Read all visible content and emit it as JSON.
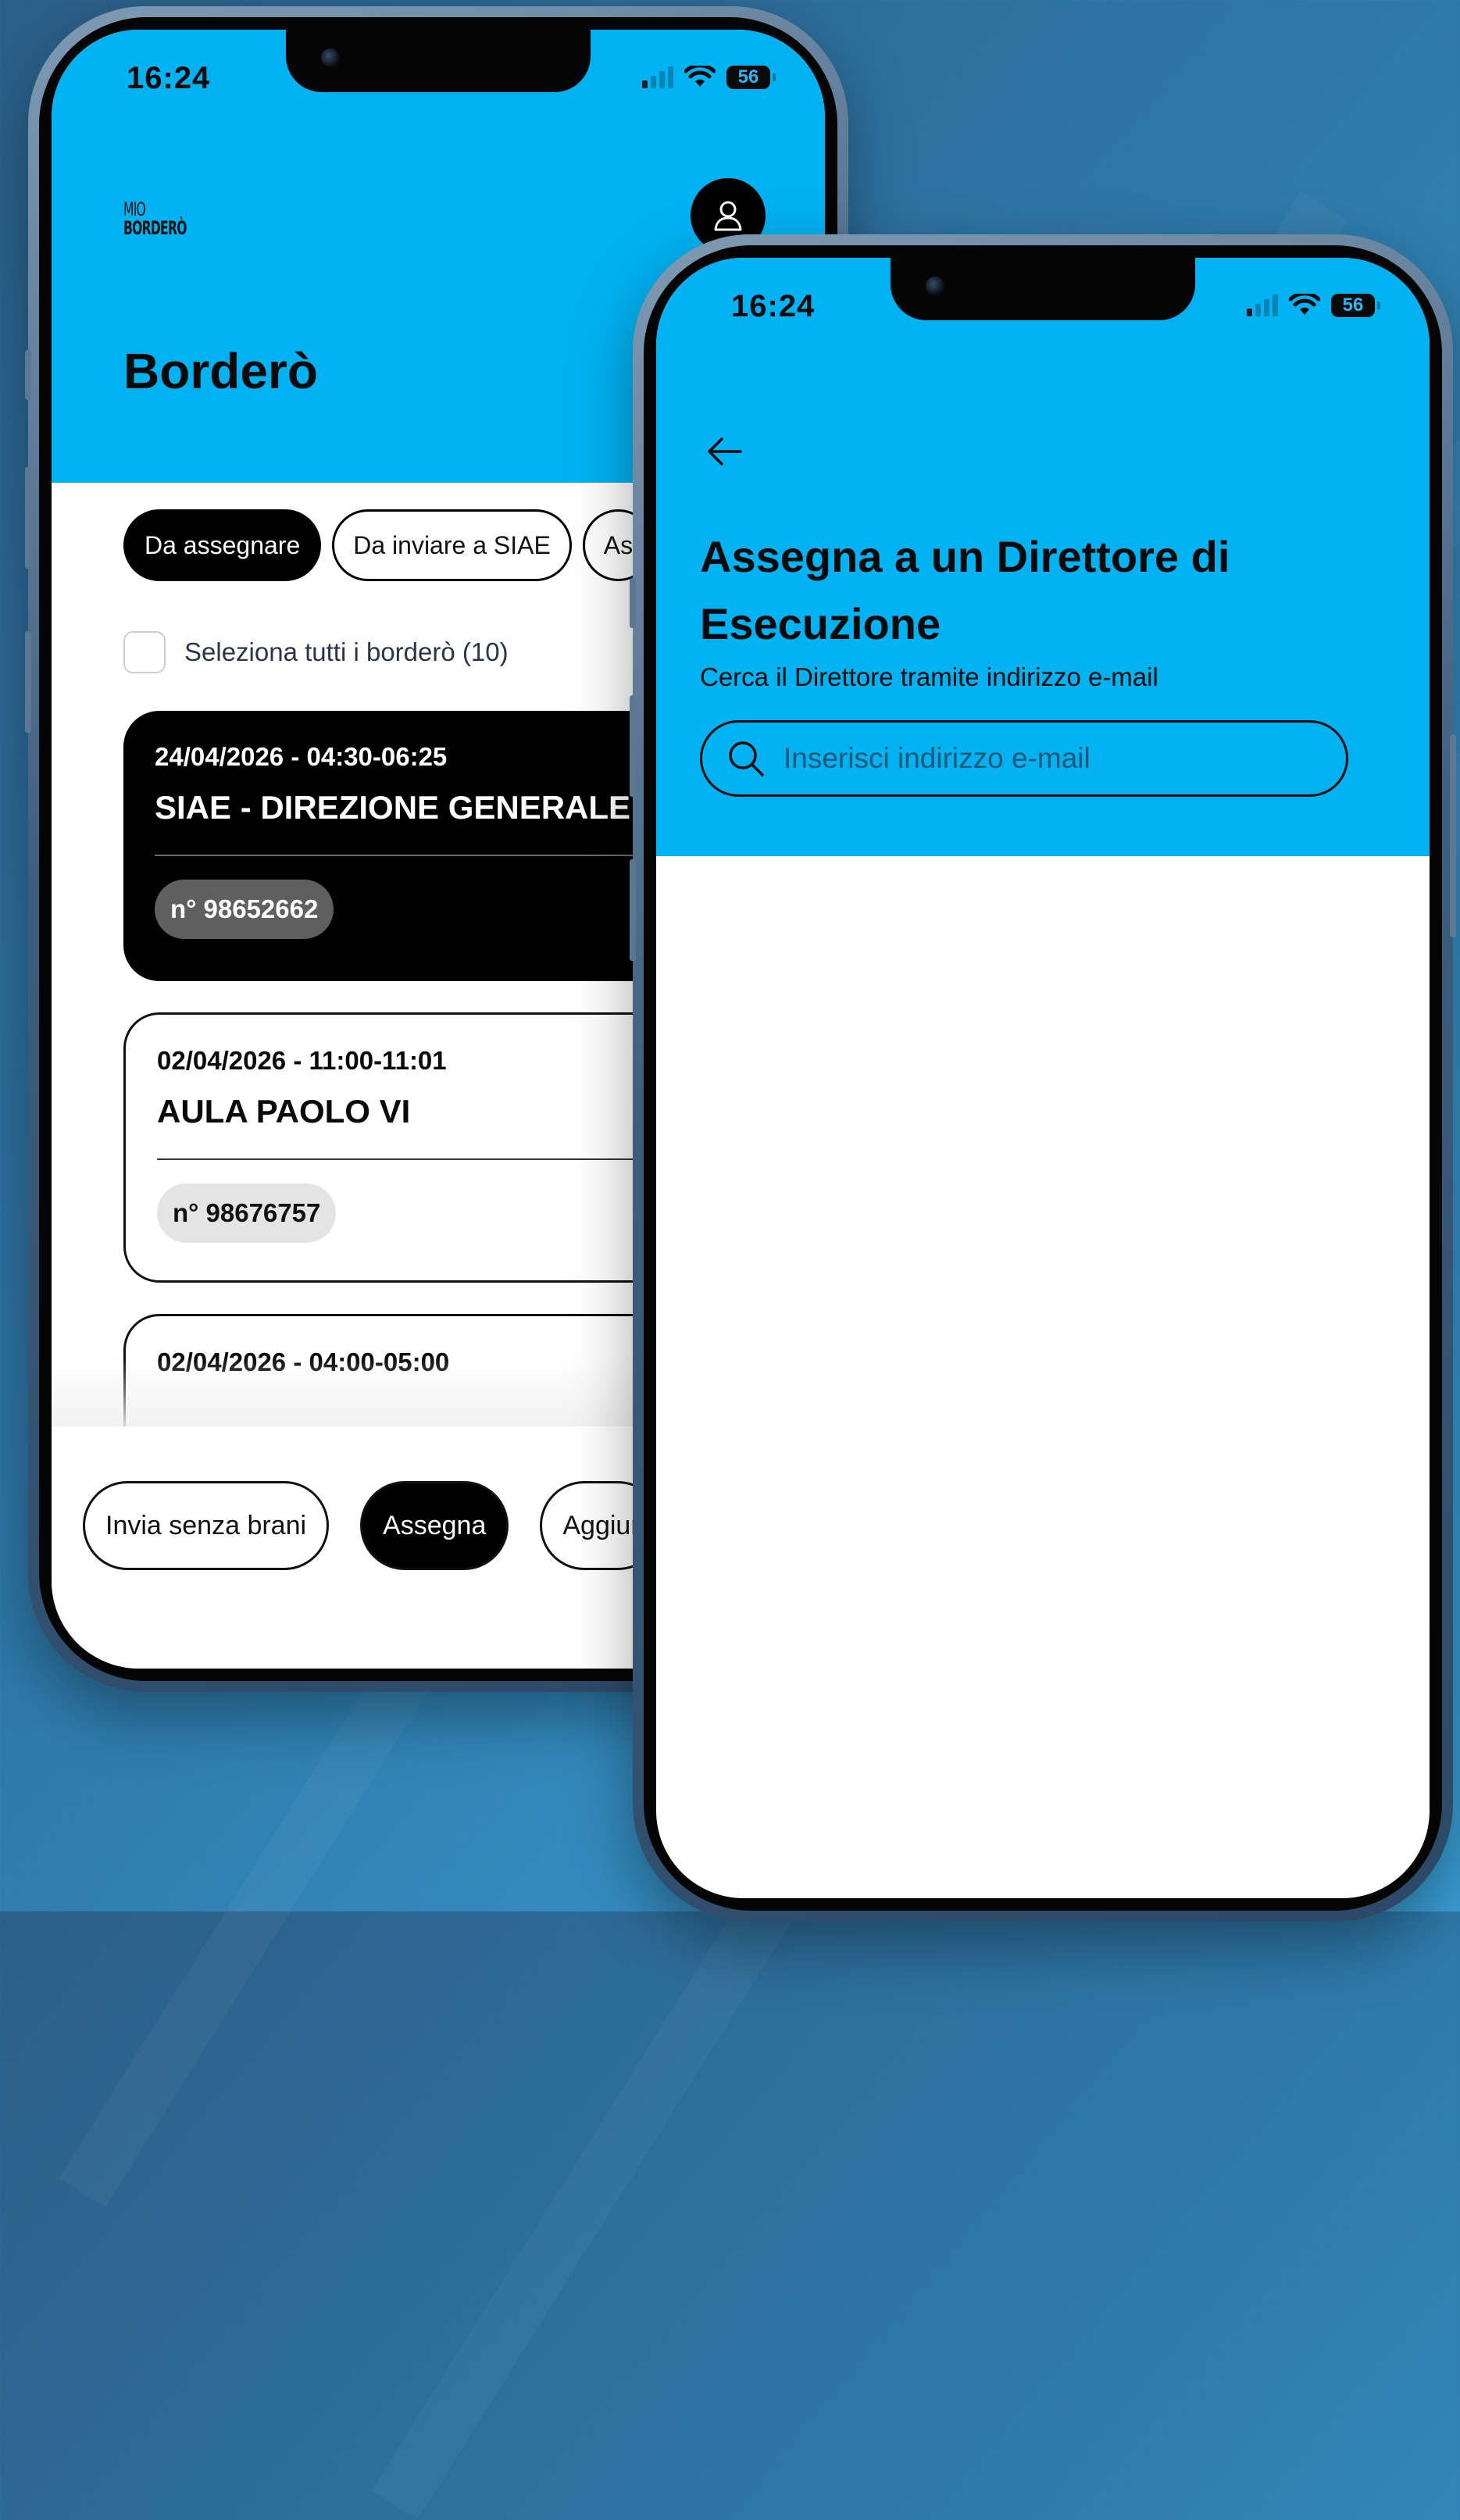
{
  "colors": {
    "brand_blue": "#00b2f2",
    "black": "#000000",
    "white": "#ffffff",
    "chip_dark": "#5f5f5f",
    "chip_light": "#e4e4e4"
  },
  "phone_list": {
    "status_bar": {
      "time": "16:24",
      "battery": "56",
      "icons": [
        "signal-icon",
        "wifi-icon",
        "battery-icon"
      ]
    },
    "logo": {
      "line1": "MIO",
      "line2": "BORDERÒ"
    },
    "profile_icon": "user-icon",
    "title": "Borderò",
    "tabs": [
      {
        "label": "Da assegnare",
        "active": true
      },
      {
        "label": "Da inviare a SIAE",
        "active": false
      },
      {
        "label": "As",
        "active": false
      }
    ],
    "select_all_label": "Seleziona tutti i borderò (10)",
    "cards": [
      {
        "date": "24/04/2026 - 04:30-06:25",
        "place": "SIAE - DIREZIONE GENERALE",
        "number": "n° 98652662",
        "selected": true
      },
      {
        "date": "02/04/2026 - 11:00-11:01",
        "place": "AULA PAOLO VI",
        "number": "n° 98676757",
        "selected": false
      },
      {
        "date": "02/04/2026 - 04:00-05:00",
        "selected": false
      }
    ],
    "actions": [
      {
        "label": "Invia senza brani"
      },
      {
        "label": "Assegna",
        "primary": true
      },
      {
        "label": "Aggiur"
      }
    ]
  },
  "phone_assign": {
    "status_bar": {
      "time": "16:24",
      "battery": "56"
    },
    "back_icon": "arrow-left-icon",
    "title": "Assegna a un Direttore di Esecuzione",
    "subtitle": "Cerca il Direttore tramite indirizzo e-mail",
    "search": {
      "placeholder": "Inserisci indirizzo e-mail",
      "value": "",
      "icon": "search-icon"
    }
  }
}
